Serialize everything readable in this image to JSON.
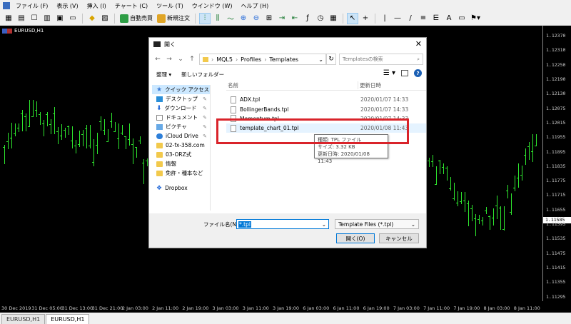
{
  "menu": {
    "items": [
      "ファイル (F)",
      "表示 (V)",
      "挿入 (I)",
      "チャート (C)",
      "ツール (T)",
      "ウインドウ (W)",
      "ヘルプ (H)"
    ]
  },
  "toolbar": {
    "auto_trade_label": "自動売買",
    "new_order_label": "新規注文"
  },
  "chart": {
    "symbol_title": "EURUSD,H1",
    "price_ticks": [
      "1.12370",
      "1.12310",
      "1.12250",
      "1.12190",
      "1.12130",
      "1.12075",
      "1.12015",
      "1.11955",
      "1.11895",
      "1.11835",
      "1.11775",
      "1.11715",
      "1.11655",
      "1.11595",
      "1.11535",
      "1.11475",
      "1.11415",
      "1.11355",
      "1.11295"
    ],
    "current_price": "1.11585",
    "time_ticks": [
      "30 Dec 2019",
      "31 Dec 05:00",
      "31 Dec 13:00",
      "31 Dec 21:00",
      "2 Jan 03:00",
      "2 Jan 11:00",
      "2 Jan 19:00",
      "3 Jan 03:00",
      "3 Jan 11:00",
      "3 Jan 19:00",
      "6 Jan 03:00",
      "6 Jan 11:00",
      "6 Jan 19:00",
      "7 Jan 03:00",
      "7 Jan 11:00",
      "7 Jan 19:00",
      "8 Jan 03:00",
      "8 Jan 11:00"
    ],
    "candle_color": "#2ee82e"
  },
  "tabs": [
    "EURUSD,H1",
    "EURUSD,H1"
  ],
  "dialog": {
    "title": "開く",
    "path": [
      "MQL5",
      "Profiles",
      "Templates"
    ],
    "search_placeholder": "Templatesの検索",
    "organize_label": "整理",
    "new_folder_label": "新しいフォルダー",
    "col_name": "名前",
    "col_date": "更新日時",
    "nav": [
      {
        "label": "クイック アクセス",
        "icon": "star-icon"
      },
      {
        "label": "デスクトップ",
        "icon": "desktop-icon"
      },
      {
        "label": "ダウンロード",
        "icon": "download-icon"
      },
      {
        "label": "ドキュメント",
        "icon": "document-icon"
      },
      {
        "label": "ピクチャ",
        "icon": "picture-icon"
      },
      {
        "label": "iCloud Drive",
        "icon": "cloud-icon"
      },
      {
        "label": "02-fx-358.com",
        "icon": "folder-icon"
      },
      {
        "label": "03-ORZ式",
        "icon": "folder-icon"
      },
      {
        "label": "情報",
        "icon": "folder-icon"
      },
      {
        "label": "免許・種本など",
        "icon": "folder-icon"
      },
      {
        "label": "Dropbox",
        "icon": "dropbox-icon"
      }
    ],
    "files": [
      {
        "name": "ADX.tpl",
        "date": "2020/01/07 14:33"
      },
      {
        "name": "BollingerBands.tpl",
        "date": "2020/01/07 14:33"
      },
      {
        "name": "Momentum.tpl",
        "date": "2020/01/07 14:33"
      },
      {
        "name": "template_chart_01.tpl",
        "date": "2020/01/08 11:43"
      }
    ],
    "tooltip": {
      "type": "種類: TPL ファイル",
      "size": "サイズ: 3.32 KB",
      "modified": "更新日時: 2020/01/08 11:43"
    },
    "filename_label": "ファイル名(N):",
    "filename_value": "*.tpl",
    "filter_value": "Template Files (*.tpl)",
    "open_label": "開く(O)",
    "cancel_label": "キャンセル"
  }
}
